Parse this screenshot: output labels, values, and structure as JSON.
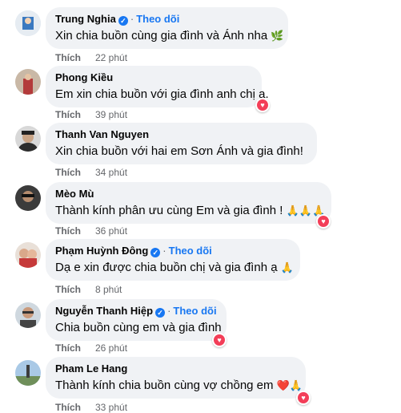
{
  "follow_label": "Theo dõi",
  "like_label": "Thích",
  "comments": [
    {
      "name": "Trung Nghia",
      "verified": true,
      "show_follow": true,
      "text": "Xin chia buồn cùng gia đình và Ánh nha",
      "emoji": "🌿",
      "time": "22 phút",
      "reaction": false
    },
    {
      "name": "Phong Kiều",
      "verified": false,
      "show_follow": false,
      "text": "Em xin chia buồn với gia đình anh chị ạ.",
      "emoji": "",
      "time": "39 phút",
      "reaction": true
    },
    {
      "name": "Thanh Van Nguyen",
      "verified": false,
      "show_follow": false,
      "text": "Xin chia buồn với hai em Sơn Ánh và gia đình!",
      "emoji": "",
      "time": "34 phút",
      "reaction": false
    },
    {
      "name": "Mèo Mù",
      "verified": false,
      "show_follow": false,
      "text": "Thành kính phân ưu cùng Em và gia đình !",
      "emoji": "🙏🙏🙏",
      "time": "36 phút",
      "reaction": true
    },
    {
      "name": "Phạm Huỳnh Đông",
      "verified": true,
      "show_follow": true,
      "text": "Dạ e xin được chia buồn chị và gia đình ạ",
      "emoji": "🙏",
      "time": "8 phút",
      "reaction": false
    },
    {
      "name": "Nguyễn Thanh Hiệp",
      "verified": true,
      "show_follow": true,
      "text": "Chia buồn cùng em và gia đình",
      "emoji": "",
      "time": "26 phút",
      "reaction": true
    },
    {
      "name": "Pham Le Hang",
      "verified": false,
      "show_follow": false,
      "text": "Thành kính chia buồn cùng vợ chồng em",
      "emoji": "❤️🙏",
      "time": "33 phút",
      "reaction": true
    }
  ]
}
